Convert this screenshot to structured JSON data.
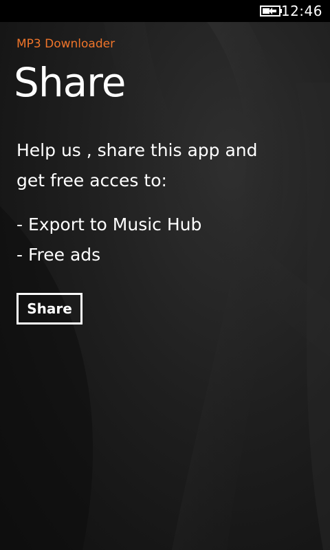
{
  "status_bar": {
    "battery_icon": "battery-charging-icon",
    "time": "12:46"
  },
  "app": {
    "name": "MP3 Downloader",
    "accent_color": "#f0752a"
  },
  "page": {
    "title": "Share",
    "lines": [
      "Help us , share this app and",
      "get free acces to:",
      "- Export to Music Hub",
      "- Free ads"
    ],
    "button_label": "Share"
  }
}
